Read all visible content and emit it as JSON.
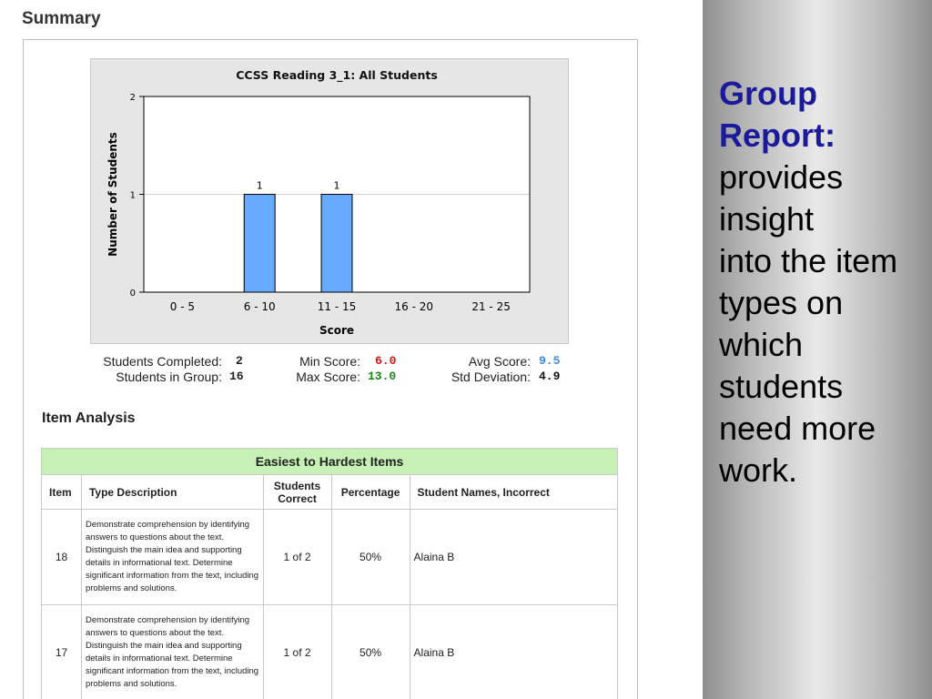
{
  "summary": {
    "heading": "Summary"
  },
  "chart_data": {
    "type": "bar",
    "title": "CCSS Reading 3_1: All Students",
    "xlabel": "Score",
    "ylabel": "Number of Students",
    "categories": [
      "0 - 5",
      "6 - 10",
      "11 - 15",
      "16 - 20",
      "21 - 25"
    ],
    "values": [
      0,
      1,
      1,
      0,
      0
    ],
    "ylim": [
      0,
      2
    ],
    "yticks": [
      0,
      1,
      2
    ],
    "data_labels": [
      "",
      "1",
      "1",
      "",
      ""
    ],
    "bar_color": "#66aaff",
    "grid": true
  },
  "stats": {
    "students_completed_label": "Students Completed:",
    "students_completed_value": "2",
    "students_in_group_label": "Students in Group:",
    "students_in_group_value": "16",
    "min_score_label": "Min Score:",
    "min_score_value": "6.0",
    "max_score_label": "Max Score:",
    "max_score_value": "13.0",
    "avg_score_label": "Avg Score:",
    "avg_score_value": "9.5",
    "std_dev_label": "Std Deviation:",
    "std_dev_value": "4.9",
    "colors": {
      "min": "#e01010",
      "max": "#138a13",
      "avg": "#3a8ee6",
      "std": "#111111"
    }
  },
  "item_analysis": {
    "heading": "Item Analysis",
    "table_title": "Easiest to Hardest Items",
    "columns": [
      "Item",
      "Type Description",
      "Students Correct",
      "Percentage",
      "Student Names, Incorrect"
    ],
    "rows": [
      {
        "item": "18",
        "description": "Demonstrate comprehension by identifying answers to questions about the text. Distinguish the main idea and supporting details in informational text. Determine significant information from the text, including problems and solutions.",
        "correct": "1 of 2",
        "percentage": "50%",
        "incorrect": "Alaina B"
      },
      {
        "item": "17",
        "description": "Demonstrate comprehension by identifying answers to questions about the text. Distinguish the main idea and supporting details in informational text. Determine significant information from the text, including problems and solutions.",
        "correct": "1 of 2",
        "percentage": "50%",
        "incorrect": "Alaina B"
      }
    ]
  },
  "sidebar": {
    "title_line1": "Group",
    "title_line2": "Report:",
    "body_lines": [
      "provides",
      "insight",
      "into the item",
      "types on",
      "which",
      "students",
      "need more",
      "work."
    ]
  }
}
